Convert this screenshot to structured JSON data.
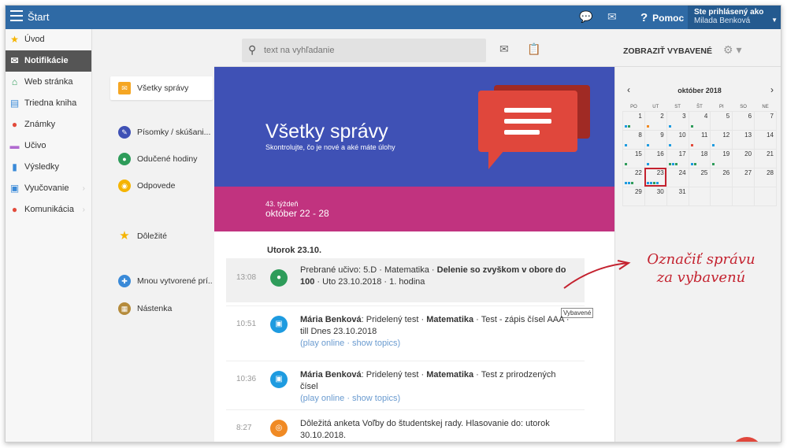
{
  "topbar": {
    "title": "Štart",
    "help_label": "Pomoc",
    "user_line1": "Ste prihlásený ako",
    "user_line2": "Milada Benková"
  },
  "sidebar": {
    "items": [
      {
        "label": "Úvod",
        "icon": "star-icon",
        "color": "#f5b400"
      },
      {
        "label": "Notifikácie",
        "icon": "envelope-icon",
        "color": "#ffffff",
        "active": true
      },
      {
        "label": "Web stránka",
        "icon": "home-icon",
        "color": "#2e9c5a"
      },
      {
        "label": "Triedna kniha",
        "icon": "book-icon",
        "color": "#3a8ad8"
      },
      {
        "label": "Známky",
        "icon": "grade-icon",
        "color": "#e24b3b"
      },
      {
        "label": "Učivo",
        "icon": "lesson-icon",
        "color": "#b06ad0"
      },
      {
        "label": "Výsledky",
        "icon": "bar-chart-icon",
        "color": "#3a8ad8"
      },
      {
        "label": "Vyučovanie",
        "icon": "teaching-icon",
        "color": "#3a8ad8"
      },
      {
        "label": "Komunikácia",
        "icon": "chat-icon",
        "color": "#e24b3b"
      }
    ]
  },
  "filters": {
    "items": [
      {
        "label": "Všetky správy",
        "icon": "envelope-icon",
        "color": "#f5a623"
      },
      {
        "label": "Písomky / skúšani...",
        "icon": "test-icon",
        "color": "#3f51b5"
      },
      {
        "label": "Odučené hodiny",
        "icon": "lesson-done-icon",
        "color": "#2e9c5a"
      },
      {
        "label": "Odpovede",
        "icon": "answers-icon",
        "color": "#f5b400"
      },
      {
        "label": "Dôležité",
        "icon": "star-icon",
        "color": "#f5b400"
      },
      {
        "label": "Mnou vytvorené prí...",
        "icon": "created-icon",
        "color": "#3a8ad8"
      },
      {
        "label": "Nástenka",
        "icon": "board-icon",
        "color": "#b58b3b"
      }
    ]
  },
  "toolbar": {
    "search_placeholder": "text na vyhľadanie",
    "show_favorites": "ZOBRAZIŤ VYBAVENÉ"
  },
  "hero": {
    "title": "Všetky správy",
    "subtitle": "Skontrolujte, čo je nové a aké máte úlohy",
    "week_label": "43. týždeň",
    "week_range": "október 22 - 28"
  },
  "feed": {
    "day_heading": "Utorok 23.10.",
    "messages": [
      {
        "time": "13:08",
        "icon": "lesson-icon",
        "color": "#2e9c5a",
        "p1": "Prebrané učivo: 5.D · Matematika · ",
        "b1": "Delenie so zvyškom v obore do 100",
        "p2": " · Uto 23.10.2018 · 1. hodina"
      },
      {
        "time": "10:51",
        "icon": "test-icon",
        "color": "#1e9be0",
        "b1": "Mária Benková",
        "p1": ": Pridelený test · ",
        "b2": "Matematika",
        "p2": " · Test - zápis čísel AAA · till Dnes 23.10.2018",
        "links": "(play online · show topics)"
      },
      {
        "time": "10:36",
        "icon": "test-icon",
        "color": "#1e9be0",
        "b1": "Mária Benková",
        "p1": ": Pridelený test · ",
        "b2": "Matematika",
        "p2": " · Test z prirodzených čísel",
        "links": "(play online · show topics)"
      },
      {
        "time": "8:27",
        "icon": "poll-icon",
        "color": "#f08a24",
        "p1": "Dôležitá anketa Voľby do študentskej rady. Hlasovanie do: utorok 30.10.2018."
      }
    ],
    "tooltip": "Vybavené"
  },
  "calendar": {
    "month": "október 2018",
    "prev": "‹",
    "next": "›",
    "weekdays": [
      "PO",
      "UT",
      "ST",
      "ŠT",
      "PI",
      "SO",
      "NE"
    ],
    "weeks": [
      [
        "1",
        "2",
        "3",
        "4",
        "5",
        "6",
        "7"
      ],
      [
        "8",
        "9",
        "10",
        "11",
        "12",
        "13",
        "14"
      ],
      [
        "15",
        "16",
        "17",
        "18",
        "19",
        "20",
        "21"
      ],
      [
        "22",
        "23",
        "24",
        "25",
        "26",
        "27",
        "28"
      ],
      [
        "29",
        "30",
        "31",
        "",
        "",
        "",
        ""
      ]
    ],
    "today": "23",
    "dot_colors": {
      "1": [
        "#1e9be0",
        "#2e9c5a"
      ],
      "2": [
        "#f08a24"
      ],
      "3": [
        "#1e9be0"
      ],
      "4": [
        "#2e9c5a"
      ],
      "8": [
        "#1e9be0"
      ],
      "9": [
        "#1e9be0"
      ],
      "10": [
        "#1e9be0"
      ],
      "11": [
        "#e24b3b"
      ],
      "12": [
        "#1e9be0"
      ],
      "15": [
        "#2e9c5a"
      ],
      "16": [
        "#1e9be0"
      ],
      "17": [
        "#2e9c5a",
        "#1e9be0",
        "#2e9c5a"
      ],
      "18": [
        "#1e9be0",
        "#2e9c5a"
      ],
      "19": [
        "#2e9c5a"
      ],
      "22": [
        "#1e9be0",
        "#1e9be0",
        "#2e9c5a"
      ],
      "23": [
        "#1e9be0",
        "#1e9be0",
        "#2e9c5a",
        "#1e9be0"
      ]
    }
  },
  "annotation": {
    "line1": "Označiť správu",
    "line2": "za vybavenú"
  },
  "colors": {
    "topbar": "#2f6aa5",
    "hero": "#3f51b5",
    "week_band": "#c1337f",
    "accent_red": "#c4222f"
  }
}
